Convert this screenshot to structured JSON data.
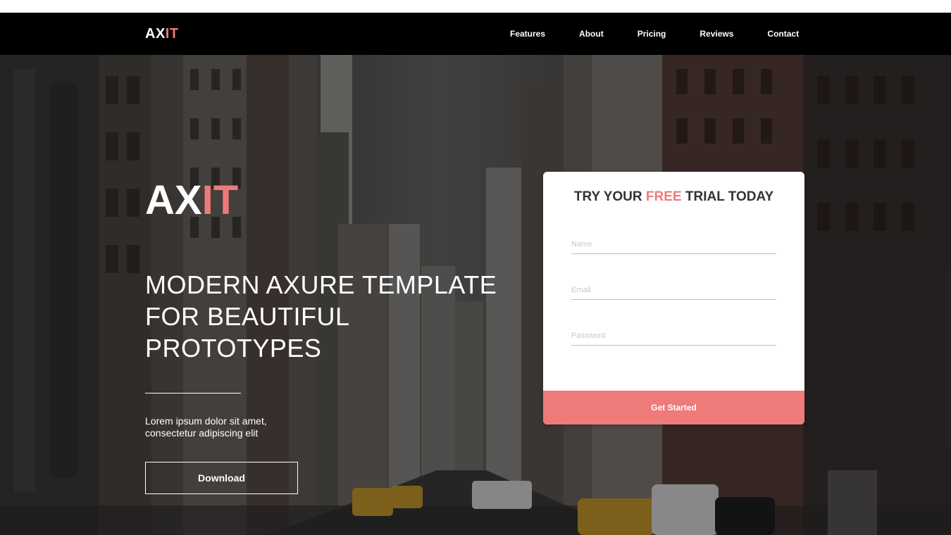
{
  "header": {
    "brand": {
      "prefix": "AX",
      "accent": "IT"
    },
    "nav": [
      "Features",
      "About",
      "Pricing",
      "Reviews",
      "Contact"
    ]
  },
  "hero": {
    "logo": {
      "prefix": "AX",
      "accent": "IT"
    },
    "headline": [
      "MODERN AXURE TEMPLATE",
      "FOR BEAUTIFUL",
      "PROTOTYPES"
    ],
    "subtext": "Lorem ipsum dolor sit amet, consectetur adipiscing elit",
    "download_label": "Download"
  },
  "trial_form": {
    "title": {
      "before": "TRY YOUR ",
      "accent": "FREE",
      "after": " TRIAL TODAY"
    },
    "fields": [
      {
        "placeholder": "Name",
        "value": ""
      },
      {
        "placeholder": "Email",
        "value": ""
      },
      {
        "placeholder": "Password",
        "value": ""
      }
    ],
    "submit_label": "Get Started"
  },
  "colors": {
    "accent": "#ef7a7a",
    "navbar_bg": "#000000",
    "text_light": "#ffffff",
    "card_title": "#333333"
  }
}
